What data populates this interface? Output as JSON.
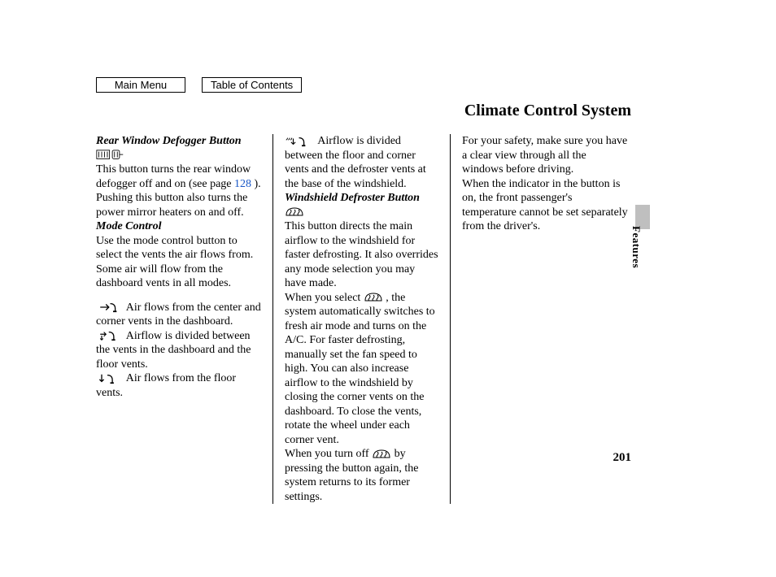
{
  "nav": {
    "main_menu": "Main Menu",
    "toc": "Table of Contents"
  },
  "title": "Climate Control System",
  "side_label": "Features",
  "page_number": "201",
  "col1": {
    "rear_defog_heading": "Rear Window Defogger Button",
    "rear_defog_p1a": "This button turns the rear window defogger off and on (see page ",
    "rear_defog_pageref": "128",
    "rear_defog_p1b": " ).",
    "rear_defog_p2": "Pushing this button also turns the power mirror heaters on and off.",
    "mode_heading": "Mode Control",
    "mode_intro": "Use the mode control button to select the vents the air flows from. Some air will flow from the dashboard vents in all modes.",
    "mode_dash": "Air flows from the center and corner vents in the dashboard.",
    "mode_dash_floor": "Airflow is divided between the vents in the dashboard and the floor vents.",
    "mode_floor": "Air flows from the floor vents."
  },
  "col2": {
    "mode_floor_def": "Airflow is divided between the floor and corner vents and the defroster vents at the base of the windshield.",
    "ws_def_heading": "Windshield Defroster Button",
    "ws_def_p1": "This button directs the main airflow to the windshield for faster defrosting. It also overrides any mode selection you may have made.",
    "ws_def_p2a": "When you select ",
    "ws_def_p2b": ", the system automatically switches to fresh air mode and turns on the A/C. For faster defrosting, manually set the fan speed to high. You can also increase airflow to the windshield by closing the corner vents on the dashboard. To close the vents, rotate the wheel under each corner vent.",
    "ws_def_p3a": "When you turn off ",
    "ws_def_p3b": " by pressing the button again, the system returns to its former settings."
  },
  "col3": {
    "safety": "For your safety, make sure you have a clear view through all the windows before driving.",
    "indicator": "When the indicator in the button is on, the front passenger's temperature cannot be set separately from the driver's."
  }
}
